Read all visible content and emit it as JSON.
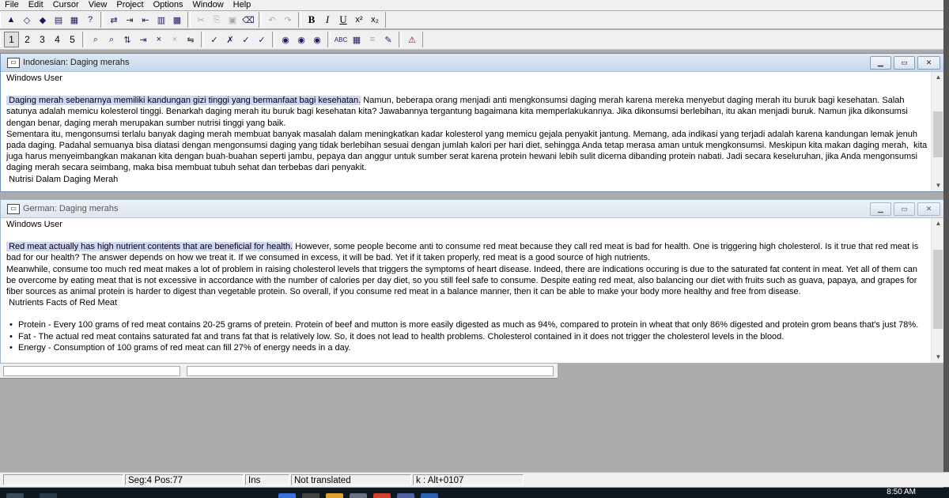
{
  "menu": [
    "File",
    "Edit",
    "Cursor",
    "View",
    "Project",
    "Options",
    "Window",
    "Help"
  ],
  "toolbar_row1": {
    "group1": [
      "open-icon",
      "erase-icon",
      "save-icon",
      "print-icon",
      "copy-doc-icon",
      "help-icon"
    ],
    "group1_glyphs": [
      "▲",
      "◇",
      "◆",
      "▤",
      "▦",
      "?"
    ],
    "group2_glyphs": [
      "⇄",
      "⇥",
      "⇤",
      "▥",
      "▩"
    ],
    "group3_glyphs": [
      "✂",
      "⎘",
      "▣",
      "⌫"
    ],
    "group4_glyphs": [
      "↶",
      "↷"
    ],
    "format": {
      "bold": "B",
      "italic": "I",
      "underline": "U",
      "superscript": "x²",
      "subscript": "x₂"
    }
  },
  "toolbar_row2": {
    "numbers": [
      "1",
      "2",
      "3",
      "4",
      "5"
    ],
    "group2_glyphs": [
      "⌕",
      "⌕",
      "⇅",
      "⇥",
      "×",
      "×",
      "⇋"
    ],
    "group3_glyphs": [
      "✓",
      "✗",
      "✓",
      "✓"
    ],
    "group4_glyphs": [
      "◉",
      "◉",
      "◉"
    ],
    "group5": {
      "spell": "ABC",
      "glyphs": [
        "▦",
        "≡",
        "✎"
      ]
    },
    "group6_glyphs": [
      "⚠"
    ]
  },
  "window1": {
    "title": "Indonesian: Daging merahs",
    "author": "Windows User",
    "highlighted": " Daging merah sebenarnya memiliki kandungan gizi tinggi yang bermanfaat bagi kesehatan.",
    "para1_rest": " Namun, beberapa orang menjadi anti mengkonsumsi daging merah karena mereka menyebut daging merah itu buruk bagi kesehatan. Salah satunya adalah memicu kolesterol tinggi. Benarkah daging merah itu buruk bagi kesehatan kita? Jawabannya tergantung bagaimana kita memperlakukannya. Jika dikonsumsi berlebihan, itu akan menjadi buruk. Namun jika dikonsumsi dengan benar, daging merah merupakan sumber nutrisi tinggi yang baik.",
    "para2": "Sementara itu, mengonsumsi terlalu banyak daging merah membuat banyak masalah dalam meningkatkan kadar kolesterol yang memicu gejala penyakit jantung. Memang, ada indikasi yang terjadi adalah karena kandungan lemak jenuh pada daging. Padahal semuanya bisa diatasi dengan mengonsumsi daging yang tidak berlebihan sesuai dengan jumlah kalori per hari diet, sehingga Anda tetap merasa aman untuk mengkonsumsi. Meskipun kita makan daging merah,  kita juga harus menyeimbangkan makanan kita dengan buah-buahan seperti jambu, pepaya dan anggur untuk sumber serat karena protein hewani lebih sulit dicerna dibanding protein nabati. Jadi secara keseluruhan, jika Anda mengonsumsi daging merah secara seimbang, maka bisa membuat tubuh sehat dan terbebas dari penyakit.",
    "heading": " Nutrisi Dalam Daging Merah"
  },
  "window2": {
    "title": "German: Daging merahs",
    "author": "Windows User",
    "highlighted": " Red meat actually has high nutrient contents that are beneficial for health.",
    "para1_rest": " However, some people become anti to consume red meat because they call red meat is bad for health. One is triggering high cholesterol. Is it true that red meat is bad for our health? The answer depends on how we treat it. If we consumed in excess, it will be bad. Yet if it taken properly, red meat is a good source of high nutrients.",
    "para2": "Meanwhile, consume too much red meat makes a lot of problem in raising cholesterol levels that triggers the symptoms of heart disease. Indeed, there are indications occuring is due to the saturated fat content in meat. Yet all of them can be overcome by eating meat that is not excessive in accordance with the number of calories per day diet, so you still feel safe to consume. Despite eating red meat, also balancing our diet with fruits such as guava, papaya, and grapes for fiber sources as animal protein is harder to digest than vegetable protein. So overall, if you consume red meat in a balance manner, then it can be able to make your body more healthy and free from disease.",
    "heading": " Nutrients Facts of Red Meat",
    "bullets": [
      "Protein - Every 100 grams of red meat contains 20-25 grams of pretein. Protein of beef and mutton is more easily digested as much as 94%, compared to protein in wheat that only 86% digested and protein grom beans that's just 78%.",
      "Fat - The actual red meat contains saturated fat and trans fat that is relatively low. So, it does not lead to health problems. Cholesterol contained in it does not trigger the cholesterol levels in the blood.",
      "Energy - Consumption of 100 grams of red meat can fill 27% of energy needs in a day."
    ],
    "bullet_char": "•"
  },
  "statusbar": {
    "segpos": "Seg:4 Pos:77",
    "mode": "Ins",
    "state": "Not translated",
    "key": "k : Alt+0107"
  },
  "clock": "8:50 AM"
}
